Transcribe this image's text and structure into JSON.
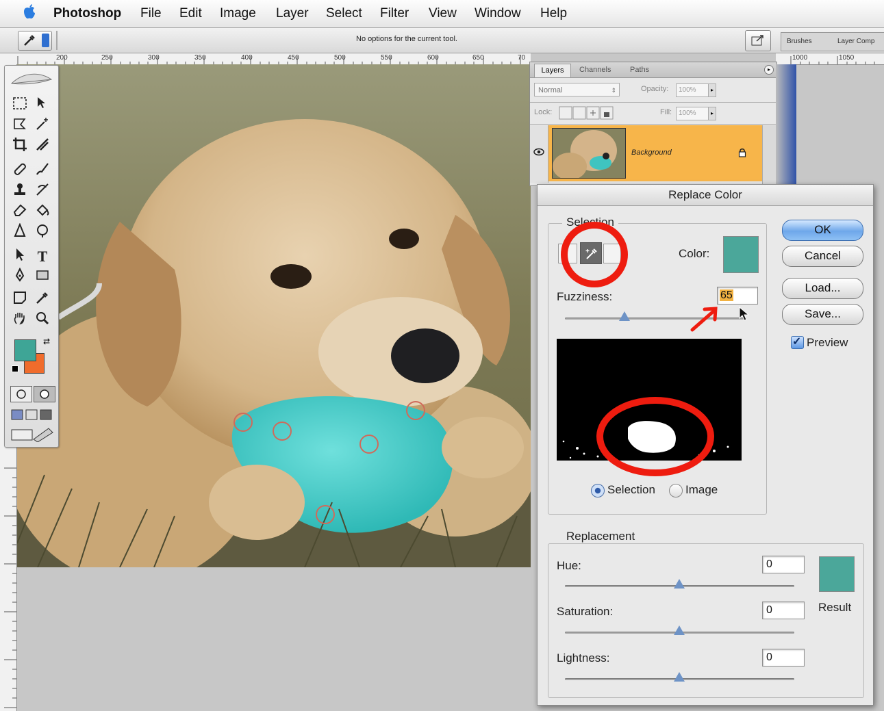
{
  "menubar": {
    "app": "Photoshop",
    "items": [
      "File",
      "Edit",
      "Image",
      "Layer",
      "Select",
      "Filter",
      "View",
      "Window",
      "Help"
    ]
  },
  "options_bar": {
    "message": "No options for the current tool.",
    "tabs": [
      "Brushes",
      "Layer Comp"
    ]
  },
  "ruler": {
    "top_ticks": [
      "200",
      "250",
      "300",
      "350",
      "400",
      "450",
      "500",
      "550",
      "600",
      "650",
      "70"
    ],
    "top_ticks_right": [
      "1000",
      "1050"
    ]
  },
  "layers_panel": {
    "tabs": [
      "Layers",
      "Channels",
      "Paths"
    ],
    "blend_mode": "Normal",
    "opacity_label": "Opacity:",
    "opacity_value": "100%",
    "lock_label": "Lock:",
    "fill_label": "Fill:",
    "fill_value": "100%",
    "layer_name": "Background"
  },
  "dialog": {
    "title": "Replace Color",
    "selection_group": "Selection",
    "color_label": "Color:",
    "fuzziness_label": "Fuzziness:",
    "fuzziness_value": "65",
    "fuzziness_level": 0.33,
    "radio_selection": "Selection",
    "radio_image": "Image",
    "replacement_group": "Replacement",
    "hue_label": "Hue:",
    "hue_value": "0",
    "saturation_label": "Saturation:",
    "saturation_value": "0",
    "lightness_label": "Lightness:",
    "lightness_value": "0",
    "result_label": "Result",
    "buttons": {
      "ok": "OK",
      "cancel": "Cancel",
      "load": "Load...",
      "save": "Save..."
    },
    "preview_label": "Preview",
    "preview_checked": true
  },
  "colors": {
    "sample": "#4ba79a",
    "result": "#4ba79a",
    "foreground": "#3ea596",
    "background": "#f06c2c",
    "annotation": "#ee1c0f",
    "layer_selected": "#f7b54a"
  },
  "icons": [
    "apple-icon",
    "eyedropper-icon",
    "eye-icon",
    "lock-icon",
    "arrow-annotation-icon",
    "cursor-icon"
  ]
}
